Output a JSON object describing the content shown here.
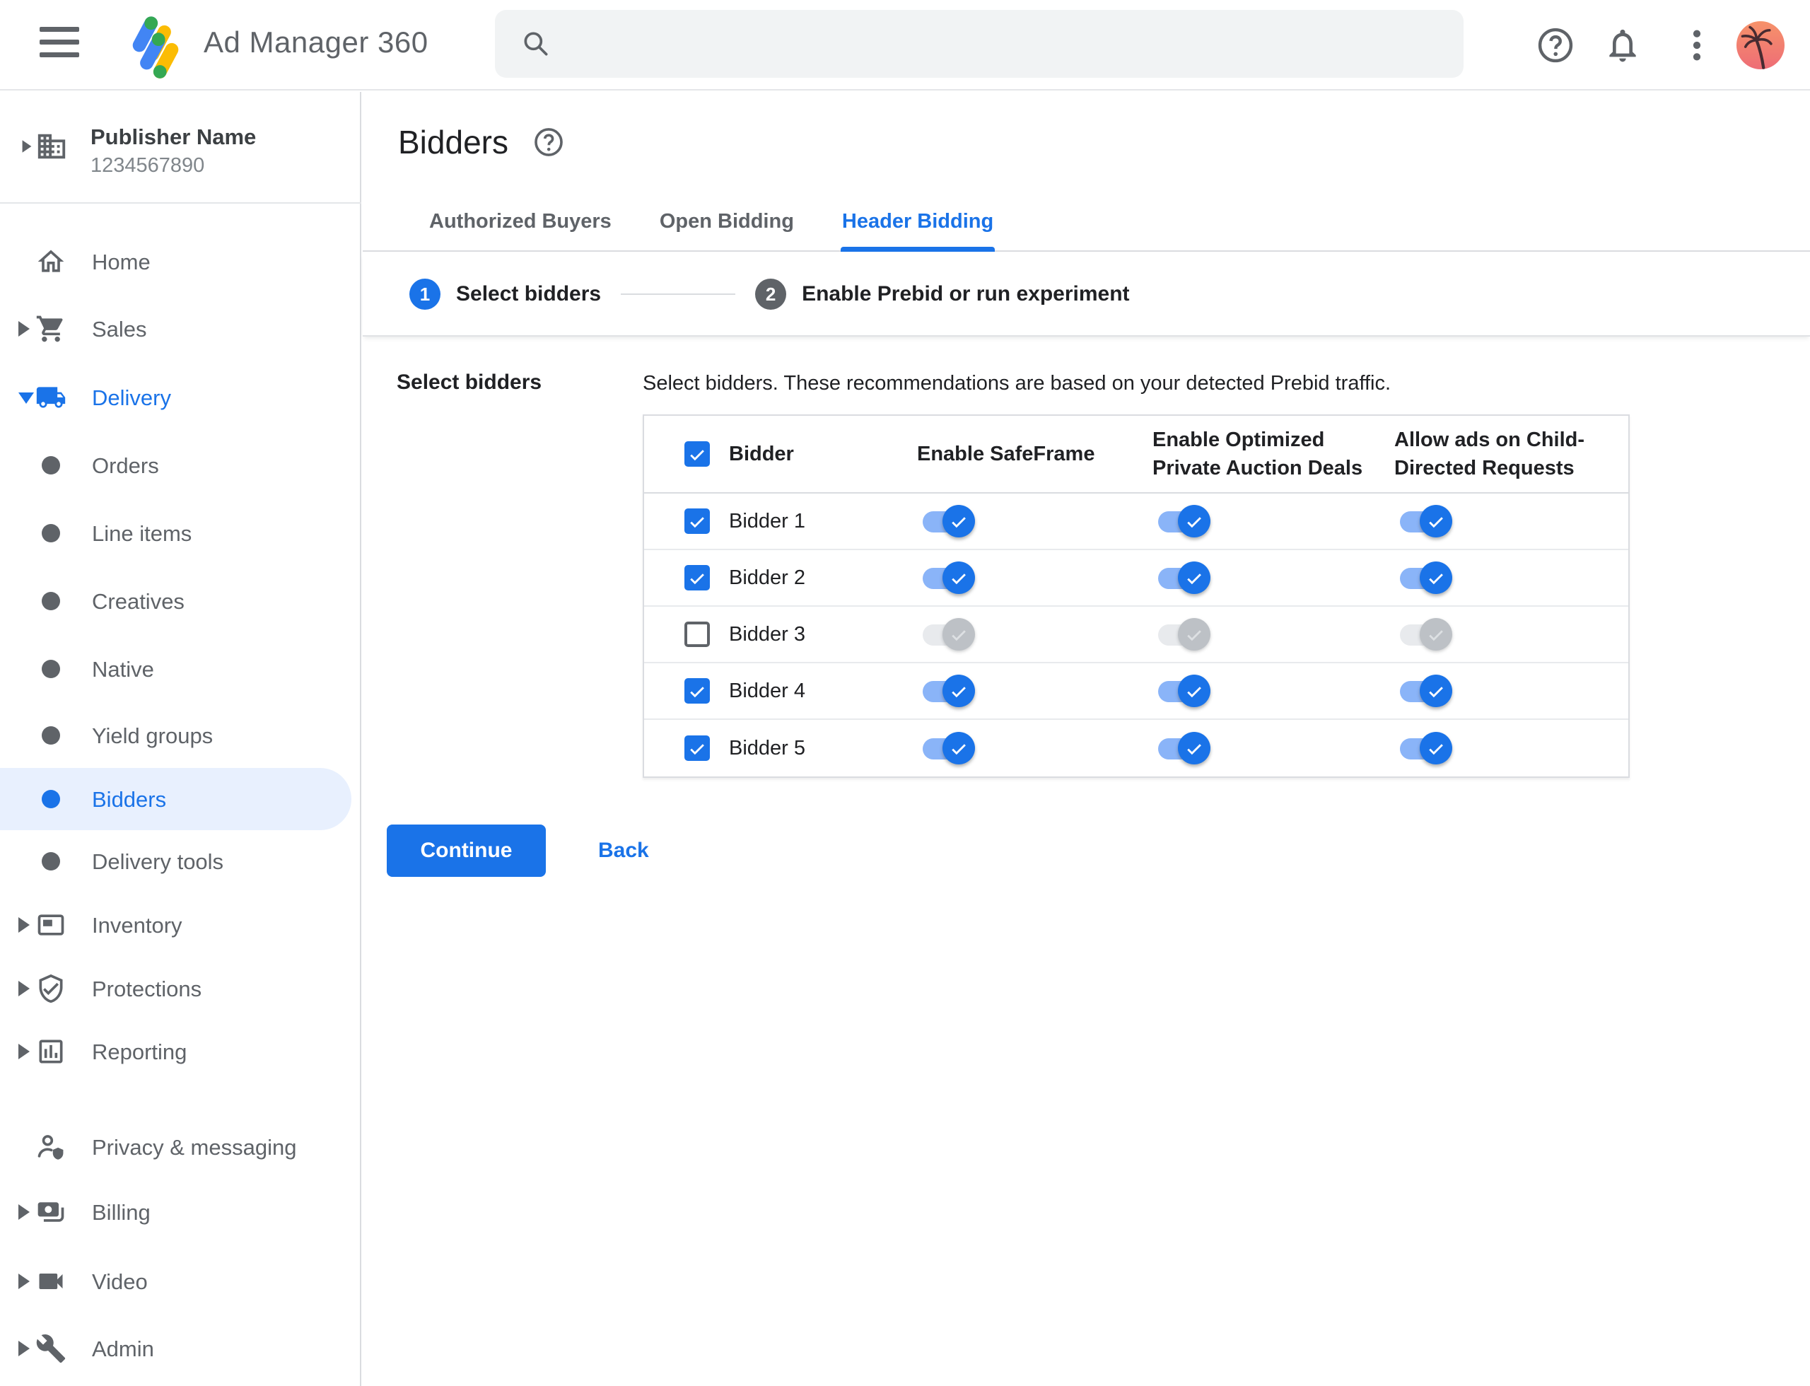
{
  "header": {
    "app_title": "Ad Manager 360",
    "search_placeholder": "",
    "icons": [
      "menu-icon",
      "search-icon",
      "help-icon",
      "notifications-icon",
      "more-vertical-icon",
      "avatar"
    ]
  },
  "sidebar": {
    "publisher": {
      "name": "Publisher Name",
      "id": "1234567890",
      "icon": "building-icon"
    },
    "items": [
      {
        "label": "Home",
        "icon": "home-icon",
        "arrow": "none",
        "level": "top",
        "state": "normal"
      },
      {
        "label": "Sales",
        "icon": "cart-icon",
        "arrow": "right",
        "level": "top",
        "state": "normal"
      },
      {
        "label": "Delivery",
        "icon": "truck-icon",
        "arrow": "down",
        "level": "top",
        "state": "expanded-active"
      },
      {
        "label": "Orders",
        "icon": "bullet",
        "arrow": "none",
        "level": "sub",
        "state": "normal"
      },
      {
        "label": "Line items",
        "icon": "bullet",
        "arrow": "none",
        "level": "sub",
        "state": "normal"
      },
      {
        "label": "Creatives",
        "icon": "bullet",
        "arrow": "none",
        "level": "sub",
        "state": "normal"
      },
      {
        "label": "Native",
        "icon": "bullet",
        "arrow": "none",
        "level": "sub",
        "state": "normal"
      },
      {
        "label": "Yield groups",
        "icon": "bullet",
        "arrow": "none",
        "level": "sub",
        "state": "normal"
      },
      {
        "label": "Bidders",
        "icon": "bullet",
        "arrow": "none",
        "level": "sub",
        "state": "selected"
      },
      {
        "label": "Delivery tools",
        "icon": "bullet",
        "arrow": "none",
        "level": "sub",
        "state": "normal"
      },
      {
        "label": "Inventory",
        "icon": "inventory-icon",
        "arrow": "right",
        "level": "top",
        "state": "normal"
      },
      {
        "label": "Protections",
        "icon": "shield-check-icon",
        "arrow": "right",
        "level": "top",
        "state": "normal"
      },
      {
        "label": "Reporting",
        "icon": "bar-chart-icon",
        "arrow": "right",
        "level": "top",
        "state": "normal"
      },
      {
        "label": "Privacy & messaging",
        "icon": "person-shield-icon",
        "arrow": "none",
        "level": "top",
        "state": "normal"
      },
      {
        "label": "Billing",
        "icon": "payments-icon",
        "arrow": "right",
        "level": "top",
        "state": "normal"
      },
      {
        "label": "Video",
        "icon": "videocam-icon",
        "arrow": "right",
        "level": "top",
        "state": "normal"
      },
      {
        "label": "Admin",
        "icon": "wrench-icon",
        "arrow": "right",
        "level": "top",
        "state": "normal"
      }
    ]
  },
  "main": {
    "page_title": "Bidders",
    "title_help_icon": "help-icon",
    "tabs": [
      {
        "label": "Authorized Buyers",
        "active": false
      },
      {
        "label": "Open Bidding",
        "active": false
      },
      {
        "label": "Header Bidding",
        "active": true
      }
    ],
    "stepper": [
      {
        "number": "1",
        "label": "Select bidders",
        "state": "current"
      },
      {
        "number": "2",
        "label": "Enable Prebid or run experiment",
        "state": "upcoming"
      }
    ],
    "section_label": "Select bidders",
    "description": "Select bidders. These recommendations are based on your detected Prebid traffic.",
    "table": {
      "select_all_checked": true,
      "columns": [
        "Bidder",
        "Enable SafeFrame",
        "Enable Optimized Private Auction Deals",
        "Allow ads on Child-Directed Requests"
      ],
      "rows": [
        {
          "name": "Bidder 1",
          "checked": true,
          "enable_safeframe": true,
          "enable_optimized_private_auction_deals": true,
          "allow_ads_child_directed": true
        },
        {
          "name": "Bidder 2",
          "checked": true,
          "enable_safeframe": true,
          "enable_optimized_private_auction_deals": true,
          "allow_ads_child_directed": true
        },
        {
          "name": "Bidder 3",
          "checked": false,
          "enable_safeframe": false,
          "enable_optimized_private_auction_deals": false,
          "allow_ads_child_directed": false
        },
        {
          "name": "Bidder 4",
          "checked": true,
          "enable_safeframe": true,
          "enable_optimized_private_auction_deals": true,
          "allow_ads_child_directed": true
        },
        {
          "name": "Bidder 5",
          "checked": true,
          "enable_safeframe": true,
          "enable_optimized_private_auction_deals": true,
          "allow_ads_child_directed": true
        }
      ]
    },
    "continue_label": "Continue",
    "back_label": "Back"
  },
  "colors": {
    "accent_blue": "#1a73e8",
    "toggle_track_on": "#8ab4f8",
    "toggle_track_off": "#e8eaed",
    "toggle_thumb_off": "#bdc1c6",
    "selected_pill": "#e8f0fe",
    "text_dark": "#202124",
    "text_gray": "#5f6368",
    "border": "#dadce0",
    "search_bg": "#f1f3f4"
  }
}
